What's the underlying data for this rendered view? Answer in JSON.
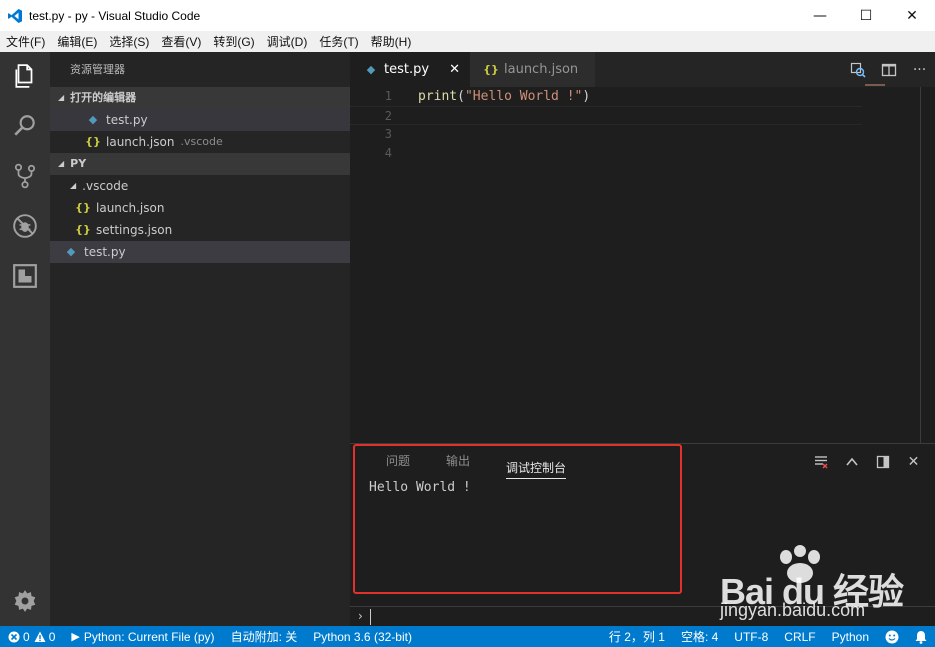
{
  "window": {
    "title": "test.py - py - Visual Studio Code",
    "controls": {
      "minimize": "—",
      "maximize": "☐",
      "close": "✕"
    }
  },
  "menu": [
    "文件(F)",
    "编辑(E)",
    "选择(S)",
    "查看(V)",
    "转到(G)",
    "调试(D)",
    "任务(T)",
    "帮助(H)"
  ],
  "activity_bar": [
    "explorer-icon",
    "search-icon",
    "source-control-icon",
    "debug-icon",
    "extensions-icon",
    "gear-icon"
  ],
  "sidebar": {
    "title": "资源管理器",
    "open_editors": {
      "header": "打开的编辑器",
      "items": [
        {
          "name": "test.py",
          "icon": "py"
        },
        {
          "name": "launch.json",
          "desc": ".vscode",
          "icon": "json"
        }
      ]
    },
    "folder": {
      "header": "PY",
      "subfolder": ".vscode",
      "subfolder_items": [
        "launch.json",
        "settings.json"
      ],
      "root_items": [
        "test.py"
      ]
    }
  },
  "editor": {
    "tabs": [
      {
        "label": "test.py",
        "active": true,
        "close": "✕"
      },
      {
        "label": "launch.json",
        "active": false
      }
    ],
    "lines": [
      {
        "n": "1",
        "fn": "print",
        "open": "(",
        "str": "\"Hello World !\"",
        "close": ")"
      },
      {
        "n": "2"
      },
      {
        "n": "3"
      },
      {
        "n": "4"
      }
    ]
  },
  "panel": {
    "tabs": [
      "问题",
      "输出",
      "调试控制台"
    ],
    "active_tab": "调试控制台",
    "output": "Hello World !",
    "prompt": "›"
  },
  "watermark": {
    "logo": "Bai du 经验",
    "url": "jingyan.baidu.com"
  },
  "status": {
    "errors": "0",
    "warnings": "0",
    "debug_config": "Python: Current File (py)",
    "auto_attach": "自动附加: 关",
    "interpreter": "Python 3.6 (32-bit)",
    "position": "行 2，列 1",
    "spaces": "空格: 4",
    "encoding": "UTF-8",
    "eol": "CRLF",
    "language": "Python"
  },
  "colors": {
    "statusbar": "#007acc",
    "activitybar": "#333333",
    "sidebar": "#252526",
    "editor": "#1e1e1e",
    "highlight": "#e0322b"
  }
}
